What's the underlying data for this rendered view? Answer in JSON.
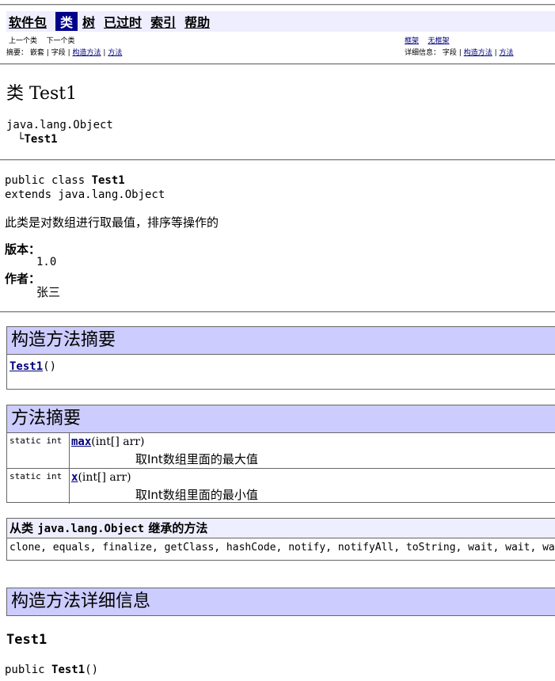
{
  "nav": {
    "items": [
      "软件包",
      "类",
      "树",
      "已过时",
      "索引",
      "帮助"
    ]
  },
  "subnav": {
    "prev_class": "上一个类",
    "next_class": "下一个类",
    "frames": "框架",
    "no_frames": "无框架",
    "summary_label": "摘要：",
    "summary_nested": "嵌套",
    "summary_field": "字段",
    "summary_constr": "构造方法",
    "summary_method": "方法",
    "detail_label": "详细信息：",
    "detail_field": "字段",
    "detail_constr": "构造方法",
    "detail_method": "方法",
    "sep": "|"
  },
  "class": {
    "title": "类 Test1",
    "hierarchy_root": "java.lang.Object",
    "hierarchy_branch": "└",
    "hierarchy_leaf": "Test1",
    "decl_prefix": "public class ",
    "decl_name": "Test1",
    "decl_extends": "extends java.lang.Object",
    "description": "此类是对数组进行取最值，排序等操作的",
    "version_label": "版本：",
    "version_value": "1.0",
    "author_label": "作者：",
    "author_value": "张三"
  },
  "constructor_summary": {
    "heading": "构造方法摘要",
    "name": "Test1",
    "parens": "()"
  },
  "method_summary": {
    "heading": "方法摘要",
    "rows": [
      {
        "type": "static int",
        "name": "max",
        "params": "(int[] arr)",
        "desc": "取Int数组里面的最大值"
      },
      {
        "type": "static int",
        "name": "x",
        "params": "(int[] arr)",
        "desc": "取Int数组里面的最小值"
      }
    ]
  },
  "inherited": {
    "heading_prefix": "从类 ",
    "heading_class": "java.lang.Object",
    "heading_suffix": " 继承的方法",
    "methods": "clone, equals, finalize, getClass, hashCode, notify, notifyAll, toString, wait, wait, wait"
  },
  "constructor_detail": {
    "heading": "构造方法详细信息",
    "name": "Test1",
    "sig_prefix": "public ",
    "sig_name": "Test1",
    "sig_suffix": "()"
  }
}
